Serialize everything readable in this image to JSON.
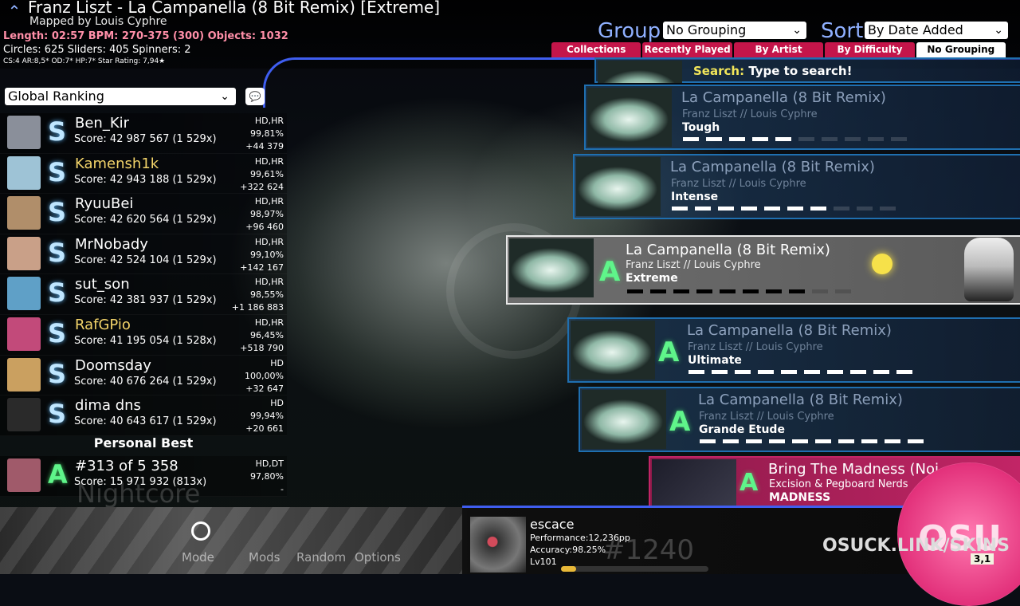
{
  "header": {
    "title": "Franz Liszt - La Campanella (8 Bit Remix) [Extreme]",
    "mapper": "Mapped by Louis Cyphre",
    "stats_line1": "Length: 02:57 BPM: 270-375 (300) Objects: 1032",
    "stats_line2": "Circles: 625 Sliders: 405 Spinners: 2",
    "stats_line3": "CS:4 AR:8,5* OD:7* HP:7* Star Rating: 7,94★",
    "group_label": "Group",
    "group_value": "No Grouping",
    "sort_label": "Sort",
    "sort_value": "By Date Added",
    "tabs": [
      "Collections",
      "Recently Played",
      "By Artist",
      "By Difficulty",
      "No Grouping"
    ]
  },
  "leaderboard": {
    "type": "Global Ranking",
    "entries": [
      {
        "name": "Ben_Kir",
        "score": "Score: 42 987 567 (1 529x)",
        "mods": "HD,HR",
        "acc": "99,81%",
        "diff": "+44 379",
        "grade": "S",
        "gold": false,
        "avatar": "#8a8f9a"
      },
      {
        "name": "Kamensh1k",
        "score": "Score: 42 943 188 (1 529x)",
        "mods": "HD,HR",
        "acc": "99,61%",
        "diff": "+322 624",
        "grade": "S",
        "gold": true,
        "avatar": "#9ec3d6"
      },
      {
        "name": "RyuuBei",
        "score": "Score: 42 620 564 (1 529x)",
        "mods": "HD,HR",
        "acc": "98,97%",
        "diff": "+96 460",
        "grade": "S",
        "gold": false,
        "avatar": "#b08e6a"
      },
      {
        "name": "MrNobady",
        "score": "Score: 42 524 104 (1 529x)",
        "mods": "HD,HR",
        "acc": "99,10%",
        "diff": "+142 167",
        "grade": "S",
        "gold": false,
        "avatar": "#c9a088"
      },
      {
        "name": "sut_son",
        "score": "Score: 42 381 937 (1 529x)",
        "mods": "HD,HR",
        "acc": "98,55%",
        "diff": "+1 186 883",
        "grade": "S",
        "gold": false,
        "avatar": "#5fa0c7"
      },
      {
        "name": "RafGPio",
        "score": "Score: 41 195 054 (1 528x)",
        "mods": "HD,HR",
        "acc": "96,45%",
        "diff": "+518 790",
        "grade": "S",
        "gold": true,
        "avatar": "#c24a7a"
      },
      {
        "name": "Doomsday",
        "score": "Score: 40 676 264 (1 529x)",
        "mods": "HD",
        "acc": "100,00%",
        "diff": "+32 647",
        "grade": "S",
        "gold": false,
        "avatar": "#caa060"
      },
      {
        "name": "dima dns",
        "score": "Score: 40 643 617 (1 529x)",
        "mods": "HD",
        "acc": "99,94%",
        "diff": "+20 661",
        "grade": "S",
        "gold": false,
        "avatar": "#2a2a2a"
      }
    ],
    "personal_best_label": "Personal Best",
    "personal_best": {
      "name": "#313 of 5 358",
      "score": "Score: 15 971 932 (813x)",
      "mods": "HD,DT",
      "acc": "97,80%",
      "diff": "-",
      "grade": "A",
      "avatar": "#a05a6a"
    },
    "nightcore": "Nightcore"
  },
  "search": {
    "label": "Search:",
    "text": "Type to search!"
  },
  "beatmaps": [
    {
      "title": "La Campanella (8 Bit Remix)",
      "artist": "Franz Liszt // Louis Cyphre",
      "diff": "Tough",
      "filled": 5,
      "total": 10
    },
    {
      "title": "La Campanella (8 Bit Remix)",
      "artist": "Franz Liszt // Louis Cyphre",
      "diff": "Intense",
      "filled": 7,
      "total": 10
    },
    {
      "title": "La Campanella (8 Bit Remix)",
      "artist": "Franz Liszt // Louis Cyphre",
      "diff": "Extreme",
      "filled": 8,
      "total": 10,
      "grade": "A"
    },
    {
      "title": "La Campanella (8 Bit Remix)",
      "artist": "Franz Liszt // Louis Cyphre",
      "diff": "Ultimate",
      "filled": 10,
      "total": 10,
      "grade": "A"
    },
    {
      "title": "La Campanella (8 Bit Remix)",
      "artist": "Franz Liszt // Louis Cyphre",
      "diff": "Grande Etude",
      "filled": 10,
      "total": 10,
      "grade": "A"
    },
    {
      "title": "Bring The Madness (Noi",
      "artist": "Excision & Pegboard Nerds",
      "diff": "MADNESS",
      "grade": "A"
    }
  ],
  "bottom": {
    "buttons": [
      "Mode",
      "Mods",
      "Random",
      "Options"
    ],
    "user": {
      "name": "escace",
      "performance": "Performance:12,236pp",
      "accuracy": "Accuracy:98.25%",
      "level": "Lv101",
      "level_progress": 0.1
    },
    "rank": "#1240",
    "osuck": "OSUCK.LINK/SKINS",
    "corner": "3,1"
  }
}
